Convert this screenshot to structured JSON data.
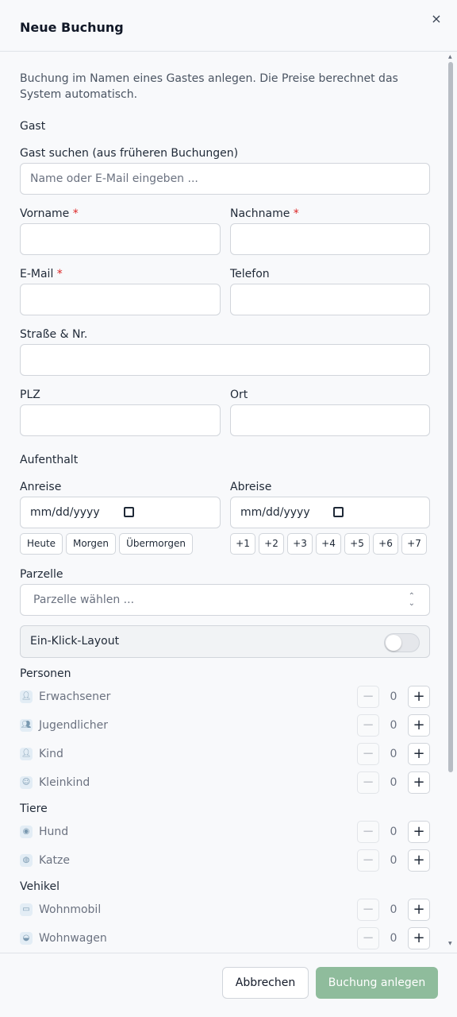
{
  "dialog": {
    "title": "Neue Buchung",
    "close_symbol": "×"
  },
  "intro": "Buchung im Namen eines Gastes anlegen. Die Preise berechnet das System automatisch.",
  "guest": {
    "section": "Gast",
    "search_label": "Gast suchen (aus früheren Buchungen)",
    "search_placeholder": "Name oder E-Mail eingeben ...",
    "firstname_label": "Vorname",
    "lastname_label": "Nachname",
    "email_label": "E-Mail",
    "phone_label": "Telefon",
    "street_label": "Straße & Nr.",
    "zip_label": "PLZ",
    "city_label": "Ort",
    "required_mark": "*"
  },
  "stay": {
    "section": "Aufenthalt",
    "arrival_label": "Anreise",
    "departure_label": "Abreise",
    "date_placeholder": "mm/dd/yyyy",
    "arrival_chips": [
      "Heute",
      "Morgen",
      "Übermorgen"
    ],
    "departure_chips": [
      "+1",
      "+2",
      "+3",
      "+4",
      "+5",
      "+6",
      "+7"
    ],
    "plot_label": "Parzelle",
    "plot_placeholder": "Parzelle wählen ...",
    "one_click_label": "Ein-Klick-Layout",
    "one_click_enabled": false
  },
  "persons": {
    "section": "Personen",
    "rows": [
      {
        "label": "Erwachsener",
        "count": "0",
        "icon": "person-icon"
      },
      {
        "label": "Jugendlicher",
        "count": "0",
        "icon": "people-icon"
      },
      {
        "label": "Kind",
        "count": "0",
        "icon": "child-icon"
      },
      {
        "label": "Kleinkind",
        "count": "0",
        "icon": "baby-icon"
      }
    ]
  },
  "animals": {
    "section": "Tiere",
    "rows": [
      {
        "label": "Hund",
        "count": "0",
        "icon": "dog-icon"
      },
      {
        "label": "Katze",
        "count": "0",
        "icon": "cat-icon"
      }
    ]
  },
  "vehicles": {
    "section": "Vehikel",
    "rows": [
      {
        "label": "Wohnmobil",
        "count": "0",
        "icon": "camper-icon"
      },
      {
        "label": "Wohnwagen",
        "count": "0",
        "icon": "caravan-icon"
      }
    ]
  },
  "stepper": {
    "minus": "−",
    "plus": "+"
  },
  "footer": {
    "cancel_label": "Abbrechen",
    "submit_label": "Buchung anlegen"
  },
  "colors": {
    "primary_disabled": "#8fbc9c",
    "required": "#dc2626"
  }
}
